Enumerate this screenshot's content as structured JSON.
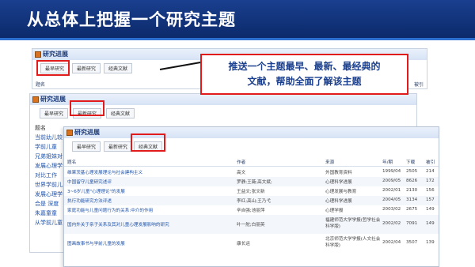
{
  "banner": {
    "title": "从总体上把握一个研究主题"
  },
  "panel_title": "研究进展",
  "tabs": [
    "最早研究",
    "最新研究",
    "经典文献"
  ],
  "callout": {
    "line1": "推送一个主题最早、最新、最经典的",
    "line2": "文献，帮助全面了解该主题"
  },
  "panel1": {
    "col_title": "题名",
    "col_cite": "被引"
  },
  "panel2": {
    "col_title": "题名",
    "titles": [
      "当前幼儿较",
      "学前儿童",
      "兄弟姐妹对",
      "发展心理学",
      "对比工作",
      "世界学前儿",
      "发展心理学",
      "合是 深度",
      "朱嘉童童",
      "从学前儿童"
    ]
  },
  "table": {
    "headers": [
      "题名",
      "作者",
      "来源",
      "年/期",
      "下载",
      "被引"
    ],
    "rows": [
      [
        "维果茨基心理发展理论与社会建构主义",
        "高文",
        "外国教育资料",
        "1999/04",
        "2505",
        "214"
      ],
      [
        "中国留守儿童研究述评",
        "罗静;王薇;高文斌;",
        "心理科学进展",
        "2009/05",
        "8626",
        "172"
      ],
      [
        "3~6岁儿童\"心理理论\"的发展",
        "王益文;张文新",
        "心理发展与教育",
        "2002/01",
        "2130",
        "156"
      ],
      [
        "执行功能研究方法评述",
        "李红;高山;王乃弋",
        "心理科学进展",
        "2004/05",
        "3134",
        "157"
      ],
      [
        "家庭功能与儿童问题行为的关系:中介的作用",
        "辛自强;池丽萍",
        "心理学报",
        "2003/02",
        "2675",
        "149"
      ],
      [
        "国内外关于亲子关系及其对儿童心理发展影响的研究",
        "叶一舵;白丽英",
        "福建师范大学学报(哲学社会科学版)",
        "2002/02",
        "7091",
        "149"
      ],
      [
        "图画故事书与学前儿童的发展",
        "康长运",
        "北京师范大学学报(人文社会科学版)",
        "2002/04",
        "3507",
        "139"
      ]
    ]
  }
}
